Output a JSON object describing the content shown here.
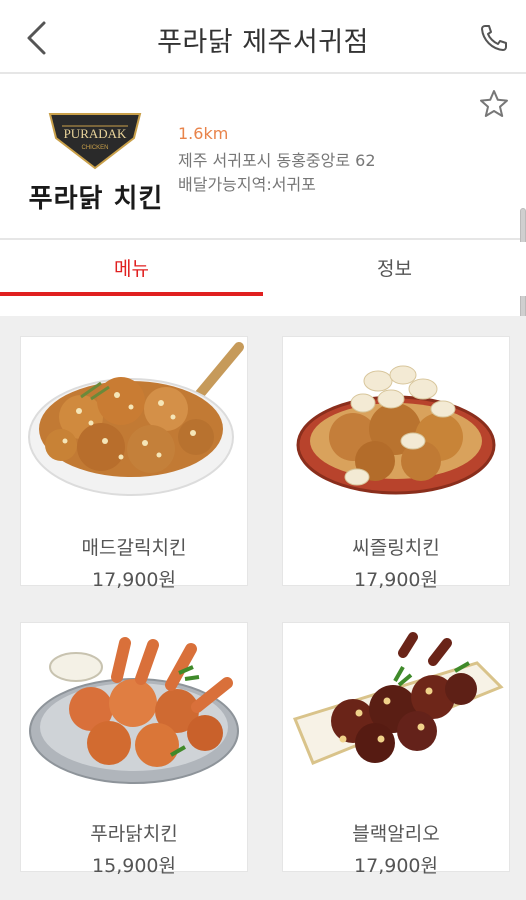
{
  "header": {
    "title": "푸라닭 제주서귀점"
  },
  "store": {
    "logo_badge_text": "PURADAK",
    "logo_badge_sub": "CHICKEN",
    "logo_text": "푸라닭 치킨",
    "distance": "1.6km",
    "address": "제주 서귀포시 동홍중앙로 62",
    "delivery_area": "배달가능지역:서귀포"
  },
  "tabs": [
    {
      "label": "메뉴",
      "active": true
    },
    {
      "label": "정보",
      "active": false
    }
  ],
  "menu": [
    {
      "name": "매드갈릭치킨",
      "price": "17,900원"
    },
    {
      "name": "씨즐링치킨",
      "price": "17,900원"
    },
    {
      "name": "푸라닭치킨",
      "price": "15,900원"
    },
    {
      "name": "블랙알리오",
      "price": "17,900원"
    }
  ],
  "colors": {
    "accent": "#e02020",
    "distance": "#e8834a",
    "badge": "#2a2a2a",
    "badge_gold": "#c9a04a"
  },
  "icons": [
    "back-arrow-icon",
    "phone-icon",
    "star-outline-icon"
  ]
}
